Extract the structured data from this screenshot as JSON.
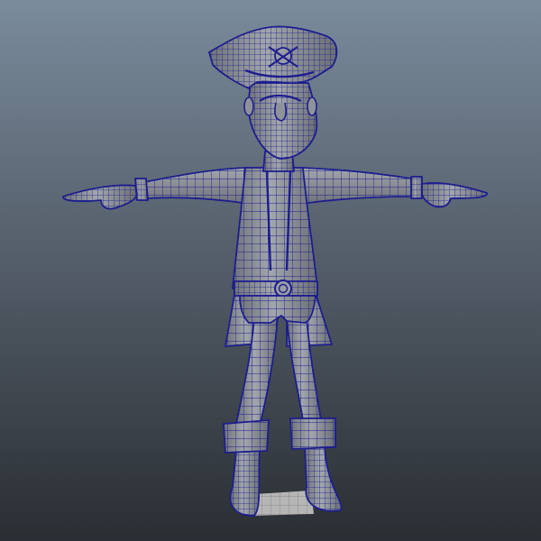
{
  "viewport": {
    "background_top": "#7a8b9c",
    "background_bottom": "#2a2e33",
    "wire_color": "#1c1d8f",
    "shade_light": "#a3a7ad",
    "shade_mid": "#8f9399",
    "shade_dark": "#707479",
    "floor_tile_color": "#b6b6b6"
  },
  "character": {
    "name": "",
    "icon": "pirate-character-model",
    "display_mode": "wireframe-on-shaded"
  }
}
